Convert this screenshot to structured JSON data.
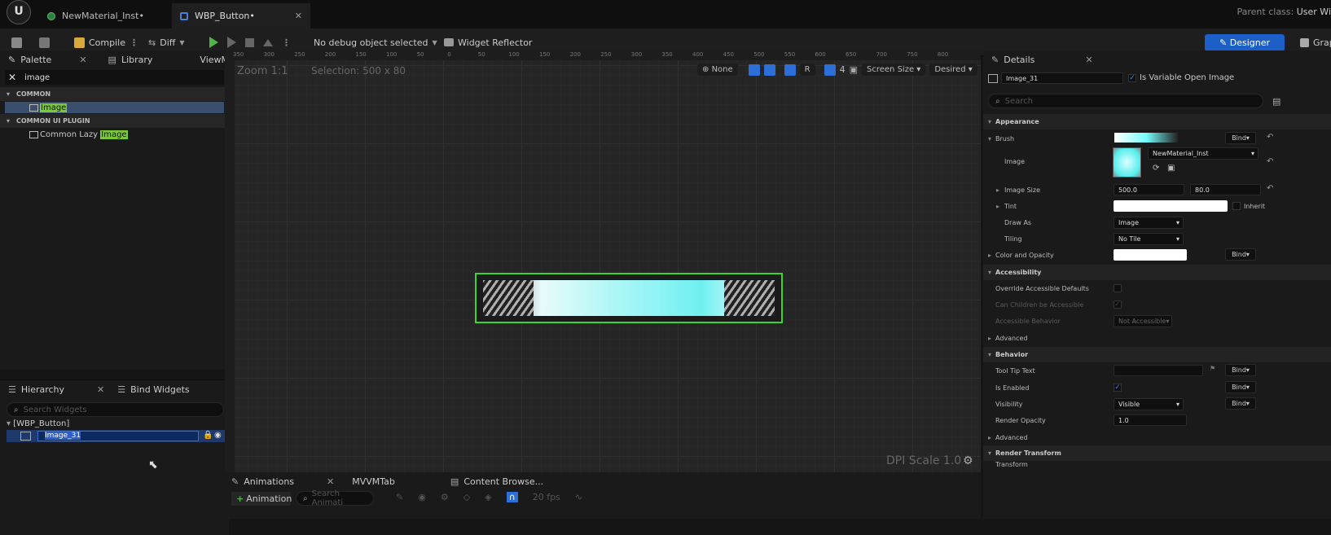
{
  "tabs": [
    {
      "label": "NewMaterial_Inst•"
    },
    {
      "label": "WBP_Button•"
    }
  ],
  "parent_class": {
    "prefix": "Parent class:",
    "value": "User Wi"
  },
  "toolbar": {
    "compile": "Compile",
    "diff": "Diff",
    "debug": "No debug object selected",
    "reflector": "Widget Reflector",
    "designer": "Designer",
    "graph": "Grap"
  },
  "palette": {
    "tabs": [
      "Palette",
      "Library",
      "ViewModel..."
    ],
    "search": "image",
    "sections": [
      {
        "title": "COMMON",
        "items": [
          {
            "prefix": "",
            "match": "Image"
          }
        ]
      },
      {
        "title": "COMMON UI PLUGIN",
        "items": [
          {
            "prefix": "Common Lazy ",
            "match": "Image"
          }
        ]
      }
    ]
  },
  "hierarchy": {
    "tabs": [
      "Hierarchy",
      "Bind Widgets"
    ],
    "search_placeholder": "Search Widgets",
    "root": "[WBP_Button]",
    "child": "Image_31"
  },
  "canvas": {
    "zoom": "Zoom 1:1",
    "selection": "Selection: 500 x 80",
    "none": "None",
    "r": "R",
    "grid_count": "4",
    "screen_size": "Screen Size",
    "desired": "Desired",
    "dpi": "DPI Scale 1.0",
    "ruler_ticks": [
      "350",
      "300",
      "250",
      "200",
      "150",
      "100",
      "50",
      "0",
      "50",
      "100",
      "150",
      "200",
      "250",
      "300",
      "350",
      "400",
      "450",
      "500",
      "550",
      "600",
      "650",
      "700",
      "750",
      "800"
    ]
  },
  "bottom": {
    "tabs": [
      "Animations",
      "MVVMTab",
      "Content Browse..."
    ],
    "animation_btn": "Animation",
    "search_placeholder": "Search Animati",
    "fps": "20 fps"
  },
  "details": {
    "title": "Details",
    "name": "Image_31",
    "is_variable": "Is Variable",
    "open_image": "Open Image",
    "search_placeholder": "Search",
    "sections": {
      "appearance": "Appearance",
      "accessibility": "Accessibility",
      "behavior": "Behavior",
      "render_transform": "Render Transform"
    },
    "brush": "Brush",
    "image": "Image",
    "image_asset": "NewMaterial_Inst",
    "image_size": "Image Size",
    "size_x": "500.0",
    "size_y": "80.0",
    "tint": "Tint",
    "inherit": "Inherit",
    "draw_as": "Draw As",
    "draw_as_val": "Image",
    "tiling": "Tiling",
    "tiling_val": "No Tile",
    "color_opacity": "Color and Opacity",
    "override_acc": "Override Accessible Defaults",
    "can_children": "Can Children be Accessible",
    "acc_behavior": "Accessible Behavior",
    "acc_behavior_val": "Not Accessible",
    "advanced": "Advanced",
    "tooltip": "Tool Tip Text",
    "is_enabled": "Is Enabled",
    "visibility": "Visibility",
    "visibility_val": "Visible",
    "render_opacity": "Render Opacity",
    "render_opacity_val": "1.0",
    "transform": "Transform",
    "bind": "Bind"
  }
}
